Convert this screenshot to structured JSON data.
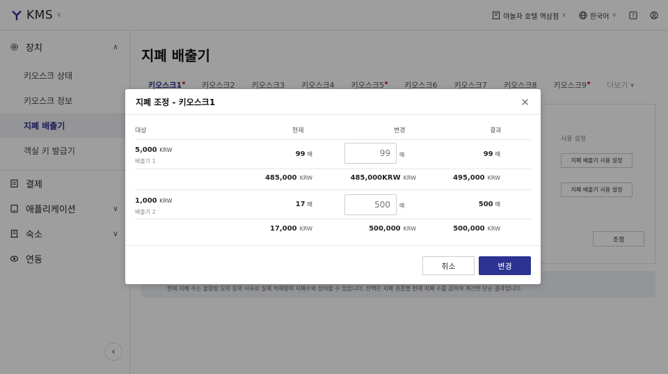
{
  "app": {
    "logo_text": "KMS",
    "hotel_name": "야놀자 호텔 역삼점",
    "language": "한국어"
  },
  "sidebar": {
    "sections": [
      {
        "label": "장치",
        "expanded": true,
        "icon": "gear-icon"
      },
      {
        "label": "결제",
        "icon": "receipt-icon"
      },
      {
        "label": "애플리케이션",
        "icon": "tablet-icon"
      },
      {
        "label": "숙소",
        "icon": "building-icon"
      },
      {
        "label": "연동",
        "icon": "link-icon"
      }
    ],
    "sub_items": [
      "키오스크 상태",
      "키오스크 정보",
      "지폐 배출기",
      "객실 키 발급기"
    ],
    "active_item": "지폐 배출기"
  },
  "main": {
    "title": "지폐 배출기",
    "tabs": [
      {
        "label": "키오스크1",
        "alert": true
      },
      {
        "label": "키오스크2",
        "alert": false
      },
      {
        "label": "키오스크3",
        "alert": false
      },
      {
        "label": "키오스크4",
        "alert": false
      },
      {
        "label": "키오스크5",
        "alert": true
      },
      {
        "label": "키오스크6",
        "alert": false
      },
      {
        "label": "키오스크7",
        "alert": false
      },
      {
        "label": "키오스크8",
        "alert": false
      },
      {
        "label": "키오스크9",
        "alert": true
      }
    ],
    "more_label": "더보기",
    "use_setting_label": "사용 설정",
    "use_setting_button": "지폐 배출기 사용 설정",
    "adjust_button": "조정",
    "notice": "현재 지폐 수는 물량장 오차 등의 사유로 실제 적재량의 지폐수와 상이할 수 있습니다. 잔액은 지폐 권종별 현재 지폐 수를 곱하여 계산한 단순 결과입니다."
  },
  "modal": {
    "title": "지폐 조정 - 키오스크1",
    "headers": {
      "target": "대상",
      "current": "현재",
      "change": "변경",
      "result": "결과"
    },
    "rows": [
      {
        "denomination": "5,000",
        "currency": "KRW",
        "dispenser": "배출기 1",
        "current_count": "99",
        "change_count": "99",
        "result_count": "99",
        "count_unit": "매",
        "current_amount": "485,000",
        "change_amount": "485,000KRW",
        "result_amount": "495,000",
        "amount_unit": "KRW"
      },
      {
        "denomination": "1,000",
        "currency": "KRW",
        "dispenser": "배출기 2",
        "current_count": "17",
        "change_count": "500",
        "result_count": "500",
        "count_unit": "매",
        "current_amount": "17,000",
        "change_amount": "500,000",
        "result_amount": "500,000",
        "amount_unit": "KRW"
      }
    ],
    "cancel_label": "취소",
    "confirm_label": "변경"
  }
}
